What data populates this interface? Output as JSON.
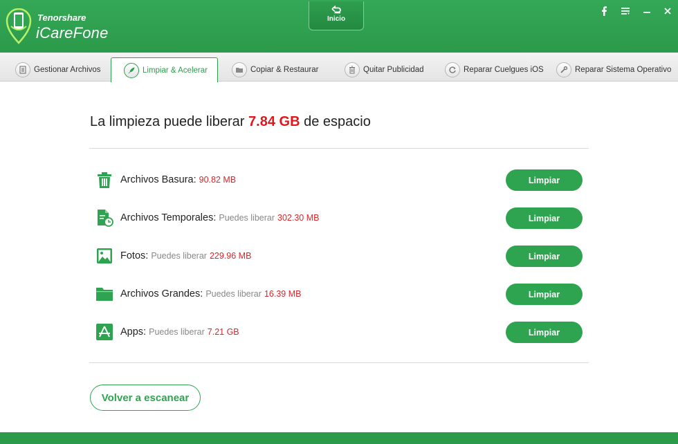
{
  "header": {
    "brand_company": "Tenorshare",
    "brand_product": "iCareFone",
    "home_label": "Inicio",
    "window_buttons": [
      "facebook-icon",
      "menu-icon",
      "minimize-icon",
      "close-icon"
    ]
  },
  "tabs": [
    {
      "label": "Gestionar Archivos",
      "icon": "file-manager-icon",
      "active": false
    },
    {
      "label": "Limpiar & Acelerar",
      "icon": "rocket-icon",
      "active": true
    },
    {
      "label": "Copiar  & Restaurar",
      "icon": "folder-backup-icon",
      "active": false
    },
    {
      "label": "Quitar Publicidad",
      "icon": "trash-icon",
      "active": false
    },
    {
      "label": "Reparar Cuelgues iOS",
      "icon": "refresh-icon",
      "active": false
    },
    {
      "label": "Reparar Sistema Operativo",
      "icon": "wrench-icon",
      "active": false
    }
  ],
  "main": {
    "headline_prefix": "La limpieza puede liberar ",
    "headline_amount": "7.84 GB",
    "headline_suffix": " de espacio",
    "items": [
      {
        "name": "Archivos Basura:",
        "sub": "",
        "size": "90.82 MB",
        "icon": "trash-can-icon",
        "button": "Limpiar"
      },
      {
        "name": "Archivos Temporales:",
        "sub": "Puedes liberar",
        "size": "302.30 MB",
        "icon": "temp-file-icon",
        "button": "Limpiar"
      },
      {
        "name": "Fotos:",
        "sub": "Puedes liberar",
        "size": "229.96 MB",
        "icon": "photo-icon",
        "button": "Limpiar"
      },
      {
        "name": "Archivos Grandes:",
        "sub": "Puedes liberar",
        "size": "16.39 MB",
        "icon": "folder-icon",
        "button": "Limpiar"
      },
      {
        "name": "Apps:",
        "sub": "Puedes liberar",
        "size": "7.21 GB",
        "icon": "app-store-icon",
        "button": "Limpiar"
      }
    ],
    "rescan_label": "Volver a escanear"
  },
  "colors": {
    "brand_green": "#2ea450",
    "highlight_red": "#e3161c"
  }
}
